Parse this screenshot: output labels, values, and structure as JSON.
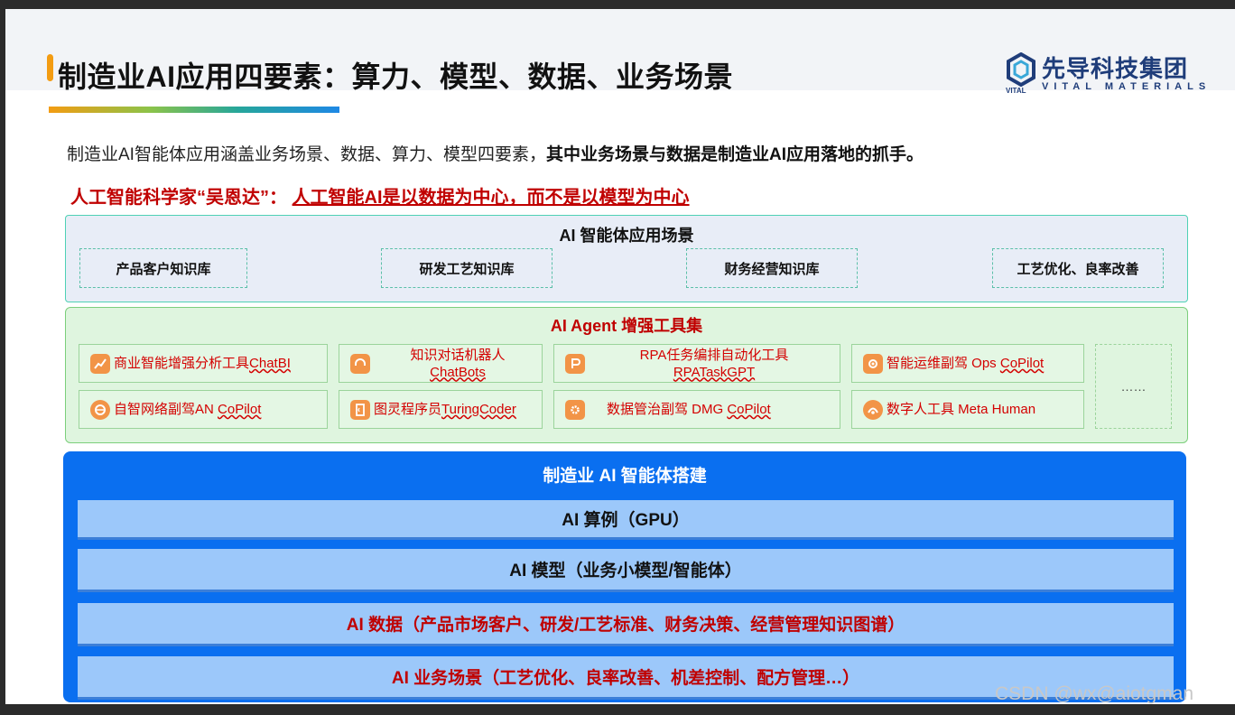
{
  "title": "制造业AI应用四要素：算力、模型、数据、业务场景",
  "logo": {
    "name": "先导科技集团",
    "sub": "VITAL MATERIALS",
    "mark_text": "VITAL"
  },
  "intro": {
    "normal": "制造业AI智能体应用涵盖业务场景、数据、算力、模型四要素，",
    "bold": "其中业务场景与数据是制造业AI应用落地的抓手。"
  },
  "quote": {
    "prefix": "人工智能科学家“吴恩达”：",
    "underlined": "人工智能AI是以数据为中心，而不是以模型为中心"
  },
  "scenarios": {
    "title": "AI 智能体应用场景",
    "items": [
      "产品客户知识库",
      "研发工艺知识库",
      "财务经营知识库",
      "工艺优化、良率改善"
    ]
  },
  "agent": {
    "title": "AI Agent 增强工具集",
    "tools": [
      {
        "prefix": "商业智能增强分析工具",
        "underlined": "ChatBI",
        "icon": "chart-icon"
      },
      {
        "prefix": "知识对话机器人",
        "underlined": "ChatBots",
        "icon": "headset-icon"
      },
      {
        "prefix": "RPA任务编排自动化工具",
        "underlined": "RPATaskGPT",
        "icon": "rpa-icon"
      },
      {
        "prefix": "智能运维副驾 Ops ",
        "underlined": "CoPilot",
        "icon": "gear-icon"
      },
      {
        "prefix": "自智网络副驾AN ",
        "underlined": "CoPilot",
        "icon": "network-icon"
      },
      {
        "prefix": "图灵程序员",
        "underlined": "TuringCoder",
        "icon": "code-icon"
      },
      {
        "prefix": "数据管治副驾 DMG ",
        "underlined": "CoPilot",
        "icon": "settings-icon"
      },
      {
        "prefix": "数字人工具 Meta Human",
        "underlined": "",
        "icon": "human-icon"
      }
    ],
    "more": "……"
  },
  "build": {
    "title": "制造业 AI 智能体搭建",
    "layers": [
      "AI 算例（GPU）",
      "AI 模型（业务小模型/智能体）",
      "AI 数据（产品市场客户、研发/工艺标准、财务决策、经营管理知识图谱）",
      "AI 业务场景（工艺优化、良率改善、机差控制、配方管理…）"
    ]
  },
  "watermark": "CSDN @wx@aiotgman",
  "colors": {
    "accent_red": "#c00000",
    "build_blue": "#0a6ff0",
    "layer_blue": "#9cc8fa",
    "agent_green": "#dff5df",
    "scenario_bg": "#e8edf7"
  }
}
